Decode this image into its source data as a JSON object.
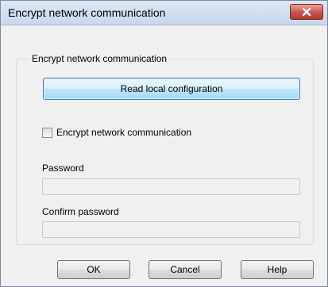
{
  "window": {
    "title": "Encrypt network communication"
  },
  "group": {
    "label": "Encrypt network communication",
    "read_button": "Read local configuration",
    "encrypt_checkbox": {
      "label": "Encrypt network communication",
      "checked": false
    },
    "password": {
      "label": "Password",
      "value": ""
    },
    "confirm_password": {
      "label": "Confirm password",
      "value": ""
    }
  },
  "footer": {
    "ok": "OK",
    "cancel": "Cancel",
    "help": "Help"
  },
  "icons": {
    "close": "close-icon"
  },
  "colors": {
    "close_button": "#c75050",
    "primary_button": "#bee6fd",
    "titlebar": "#c7d8ec"
  }
}
